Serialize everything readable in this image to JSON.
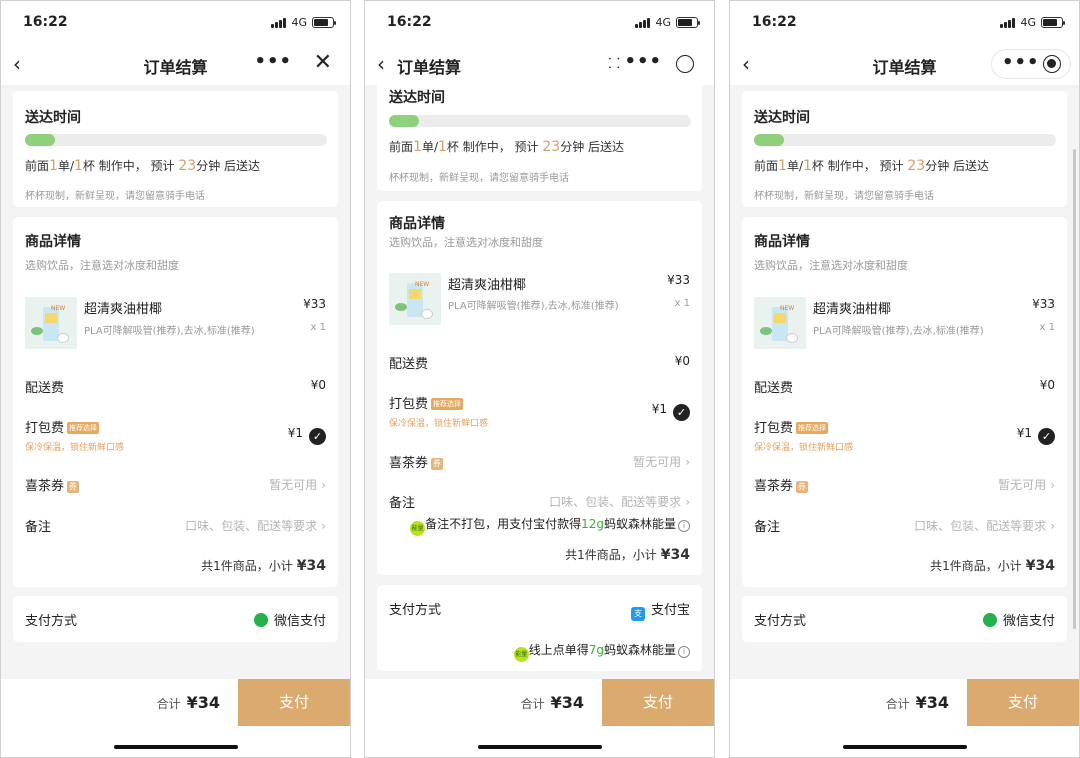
{
  "status": {
    "time": "16:22",
    "network": "4G"
  },
  "nav": {
    "back_icon": "‹",
    "title": "订单结算",
    "more_icon": "•••",
    "close_icon": "✕"
  },
  "delivery": {
    "title": "送达时间",
    "progress": 0.1,
    "queue_prefix": "前面",
    "orders": "1",
    "orders_unit": "单/",
    "cups": "1",
    "cups_unit": "杯 制作中，  预计",
    "minutes": "23",
    "minutes_suffix": "分钟 后送达",
    "hint": "杯杯现制，新鲜呈现，请您留意骑手电话"
  },
  "goods": {
    "title": "商品详情",
    "subtitle": "选购饮品，注意选对冰度和甜度",
    "thumb_tag": "NEW",
    "product": {
      "name": "超清爽油柑椰",
      "spec": "PLA可降解吸管(推荐),去冰,标准(推荐)",
      "price": "¥33",
      "qty": "x 1"
    },
    "delivery_fee_label": "配送费",
    "delivery_fee": "¥0",
    "packing_label": "打包费",
    "packing_badge": "推荐选择",
    "packing_hint": "保冷保温，锁住新鲜口感",
    "packing_fee": "¥1",
    "check_icon": "✓",
    "coupon_label": "喜茶券",
    "coupon_badge": "券",
    "coupon_value": "暂无可用",
    "remark_label": "备注",
    "remark_placeholder": "口味、包装、配送等要求",
    "chevron": "›",
    "subtotal_text": "共1件商品，小计",
    "subtotal_value": "¥34"
  },
  "eco": {
    "badge": "能量",
    "remark_prefix": "备注不打包，用支付宝付款得",
    "remark_amount": "12g",
    "remark_suffix": "蚂蚁森林能量",
    "pay_prefix": "线上点单得",
    "pay_amount": "7g",
    "pay_suffix": "蚂蚁森林能量",
    "info_icon": "i"
  },
  "payment": {
    "label": "支付方式",
    "wechat": "微信支付",
    "alipay": "支付宝",
    "alipay_icon": "支"
  },
  "footer": {
    "total_label": "合计",
    "total_value": "¥34",
    "pay_button": "支付"
  },
  "colors": {
    "accent": "#dbaa6e",
    "highlight": "#d4a06a",
    "progress": "#8fd07a",
    "wechat": "#22b24c",
    "alipay": "#1a9bf0"
  }
}
